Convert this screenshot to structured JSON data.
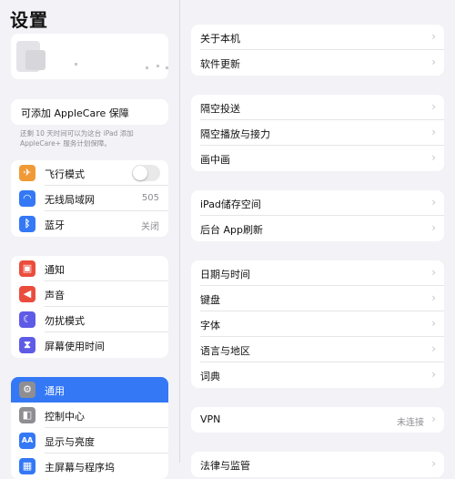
{
  "sidebar": {
    "title": "设置",
    "applecare_label": "可添加 AppleCare 保障",
    "applecare_note": "还剩 10 天时间可以为这台 iPad 添加 AppleCare+ 服务计划保障。",
    "group1": [
      {
        "label": "飞行模式",
        "icon": "airplane-icon",
        "color": "#f09a37",
        "glyph": "✈"
      },
      {
        "label": "无线局域网",
        "value": "505",
        "icon": "wifi-icon",
        "color": "#3478f6",
        "glyph": "◠"
      },
      {
        "label": "蓝牙",
        "value": "关闭",
        "icon": "bluetooth-icon",
        "color": "#3478f6",
        "glyph": "ᛒ"
      }
    ],
    "group2": [
      {
        "label": "通知",
        "icon": "notification-icon",
        "color": "#eb4d3d",
        "glyph": "▣"
      },
      {
        "label": "声音",
        "icon": "sound-icon",
        "color": "#eb4d3d",
        "glyph": "◀"
      },
      {
        "label": "勿扰模式",
        "icon": "moon-icon",
        "color": "#5e5ce6",
        "glyph": "☾"
      },
      {
        "label": "屏幕使用时间",
        "icon": "hourglass-icon",
        "color": "#5e5ce6",
        "glyph": "⧗"
      }
    ],
    "group3": [
      {
        "label": "通用",
        "icon": "gear-icon",
        "color": "#8e8e93",
        "glyph": "⚙"
      },
      {
        "label": "控制中心",
        "icon": "control-center-icon",
        "color": "#8e8e93",
        "glyph": "◧"
      },
      {
        "label": "显示与亮度",
        "icon": "display-icon",
        "color": "#3478f6",
        "glyph": "AA"
      },
      {
        "label": "主屏幕与程序坞",
        "icon": "home-screen-icon",
        "color": "#3478f6",
        "glyph": "▦"
      }
    ],
    "airplane_mode_on": false
  },
  "detail": {
    "group1": [
      {
        "label": "关于本机"
      },
      {
        "label": "软件更新"
      }
    ],
    "group2": [
      {
        "label": "隔空投送"
      },
      {
        "label": "隔空播放与接力"
      },
      {
        "label": "画中画"
      }
    ],
    "group3": [
      {
        "label": "iPad储存空间"
      },
      {
        "label": "后台 App刷新"
      }
    ],
    "group4": [
      {
        "label": "日期与时间"
      },
      {
        "label": "键盘"
      },
      {
        "label": "字体"
      },
      {
        "label": "语言与地区"
      },
      {
        "label": "词典"
      }
    ],
    "group5": [
      {
        "label": "VPN",
        "value": "未连接"
      }
    ],
    "group6": [
      {
        "label": "法律与监管"
      }
    ],
    "chevron": "›"
  },
  "colors": {
    "accent": "#3478f6",
    "background": "#f2f2f7",
    "secondary_text": "#8e8e93"
  }
}
